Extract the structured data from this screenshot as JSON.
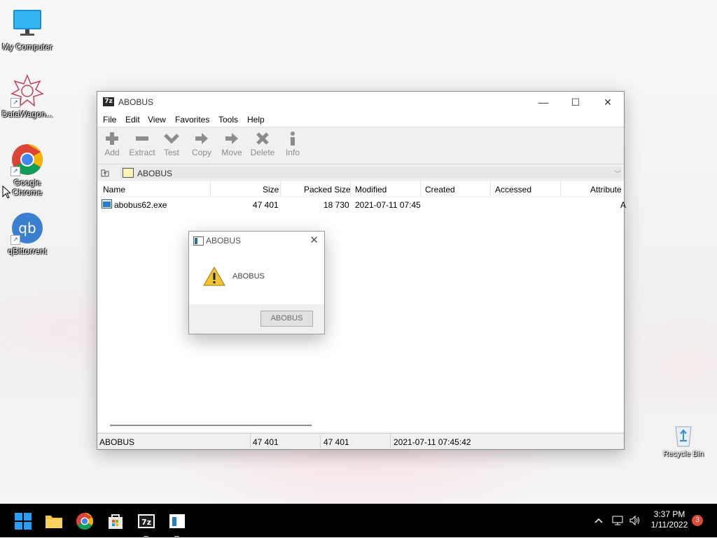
{
  "desktop": {
    "icons": [
      {
        "label": "My Computer"
      },
      {
        "label": "DataWagon..."
      },
      {
        "label": "Google Chrome"
      },
      {
        "label": "qBittorrent"
      }
    ],
    "recycle_bin": "Recycle Bin"
  },
  "window": {
    "app_icon_text": "7z",
    "title": "ABOBUS",
    "menu": [
      "File",
      "Edit",
      "View",
      "Favorites",
      "Tools",
      "Help"
    ],
    "toolbar": [
      "Add",
      "Extract",
      "Test",
      "Copy",
      "Move",
      "Delete",
      "Info"
    ],
    "address": "ABOBUS",
    "columns": [
      "Name",
      "Size",
      "Packed Size",
      "Modified",
      "Created",
      "Accessed",
      "Attribute"
    ],
    "rows": [
      {
        "name": "abobus62.exe",
        "size": "47 401",
        "packed": "18 730",
        "modified": "2021-07-11 07:45",
        "created": "",
        "accessed": "",
        "attr": "A"
      }
    ],
    "status": {
      "name": "ABOBUS",
      "size": "47 401",
      "packed": "47 401",
      "modified": "2021-07-11 07:45:42"
    }
  },
  "dialog": {
    "title": "ABOBUS",
    "message": "ABOBUS",
    "button": "ABOBUS"
  },
  "taskbar": {
    "time": "3:37 PM",
    "date": "1/11/2022",
    "notifications": "3"
  },
  "colors": {
    "taskbar": "#000000",
    "titlebar": "#ffffff",
    "window_bg": "#f0f0f0",
    "badge": "#e04a3a"
  }
}
